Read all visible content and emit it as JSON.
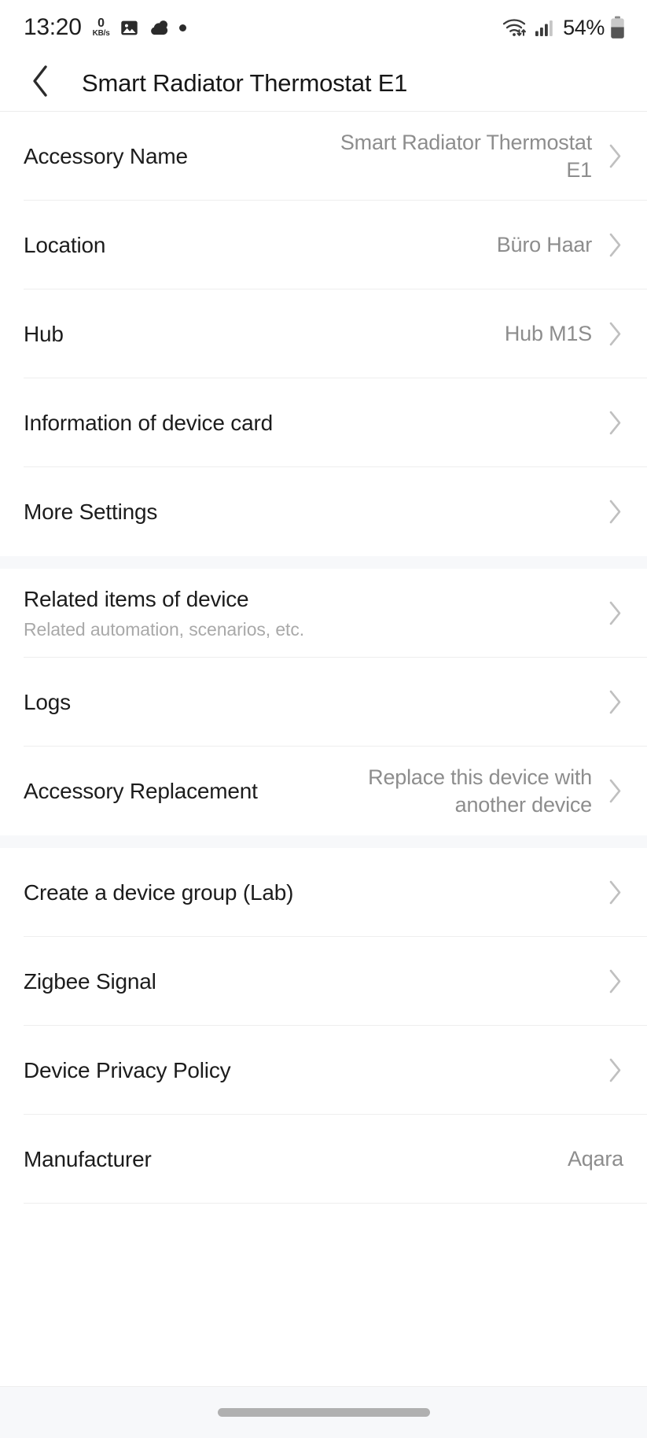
{
  "status_bar": {
    "time": "13:20",
    "network_speed_value": "0",
    "network_speed_unit": "KB/s",
    "icons": [
      "image-icon",
      "weather-cloud-icon",
      "dot-icon"
    ],
    "wifi_icon": "wifi-data-transfer-icon",
    "signal_icon": "cellular-signal-icon",
    "battery_percent": "54%",
    "battery_icon": "battery-icon"
  },
  "header": {
    "back_icon": "chevron-left-icon",
    "title": "Smart Radiator Thermostat E1"
  },
  "sections": [
    {
      "rows": [
        {
          "label": "Accessory Name",
          "value": "Smart Radiator Thermostat E1",
          "sub": "",
          "chevron": true
        },
        {
          "label": "Location",
          "value": "Büro Haar",
          "sub": "",
          "chevron": true
        },
        {
          "label": "Hub",
          "value": "Hub M1S",
          "sub": "",
          "chevron": true
        },
        {
          "label": "Information of device card",
          "value": "",
          "sub": "",
          "chevron": true
        },
        {
          "label": "More Settings",
          "value": "",
          "sub": "",
          "chevron": true
        }
      ]
    },
    {
      "rows": [
        {
          "label": "Related items of device",
          "value": "",
          "sub": "Related automation, scenarios, etc.",
          "chevron": true
        },
        {
          "label": "Logs",
          "value": "",
          "sub": "",
          "chevron": true
        },
        {
          "label": "Accessory Replacement",
          "value": "Replace this device with another device",
          "sub": "",
          "chevron": true
        }
      ]
    },
    {
      "rows": [
        {
          "label": "Create a device group (Lab)",
          "value": "",
          "sub": "",
          "chevron": true
        },
        {
          "label": "Zigbee Signal",
          "value": "",
          "sub": "",
          "chevron": true
        },
        {
          "label": "Device Privacy Policy",
          "value": "",
          "sub": "",
          "chevron": true
        },
        {
          "label": "Manufacturer",
          "value": "Aqara",
          "sub": "",
          "chevron": false
        }
      ]
    }
  ],
  "bottom_nav": {
    "home_indicator": "home-indicator-pill"
  },
  "colors": {
    "background": "#ffffff",
    "section_gap": "#f7f8fa",
    "divider": "#eeeeee",
    "label_text": "#1c1c1c",
    "value_text": "#8d8d8d",
    "sub_text": "#a9a9a9",
    "chevron": "#c0c0c0"
  }
}
